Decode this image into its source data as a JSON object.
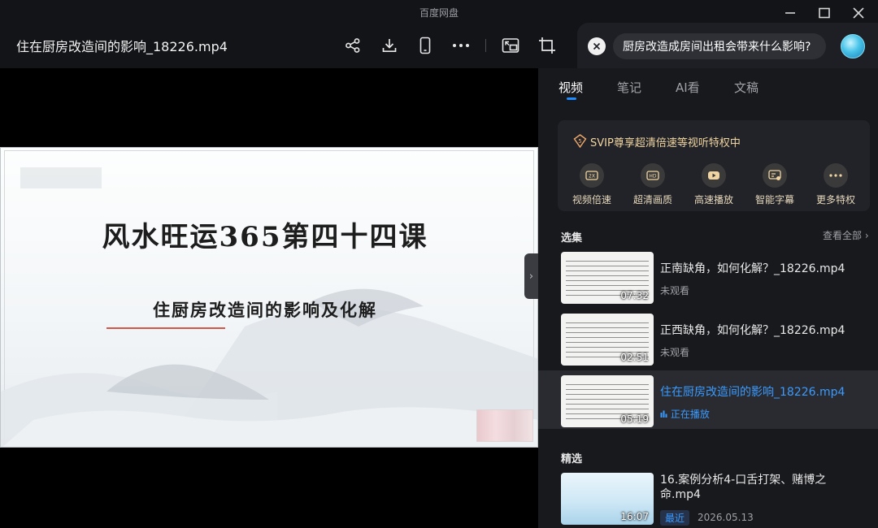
{
  "app": {
    "title": "百度网盘",
    "file_title": "住在厨房改造间的影响_18226.mp4"
  },
  "toolbar": {
    "icons": [
      "share-icon",
      "download-icon",
      "phone-icon",
      "more-icon",
      "pip-icon",
      "fullscreen-icon"
    ]
  },
  "search": {
    "query": "厨房改造成房间出租会带来什么影响?"
  },
  "slide": {
    "title": "风水旺运365第四十四课",
    "subtitle": "住厨房改造间的影响及化解"
  },
  "tabs": [
    {
      "label": "视频",
      "active": true
    },
    {
      "label": "笔记",
      "active": false
    },
    {
      "label": "AI看",
      "active": false
    },
    {
      "label": "文稿",
      "active": false
    }
  ],
  "svip": {
    "banner": "SVIP尊享超清倍速等视听特权中",
    "privileges": [
      {
        "label": "视频倍速",
        "icon": "speed-icon"
      },
      {
        "label": "超清画质",
        "icon": "hd-icon"
      },
      {
        "label": "高速播放",
        "icon": "fast-play-icon"
      },
      {
        "label": "智能字幕",
        "icon": "subtitle-icon"
      },
      {
        "label": "更多特权",
        "icon": "more-icon"
      }
    ]
  },
  "episodes": {
    "section_title": "选集",
    "view_all": "查看全部",
    "items": [
      {
        "title": "正南缺角，如何化解？_18226.mp4",
        "status": "未观看",
        "duration": "07:32",
        "current": false
      },
      {
        "title": "正西缺角，如何化解？_18226.mp4",
        "status": "未观看",
        "duration": "02:51",
        "current": false
      },
      {
        "title": "住在厨房改造间的影响_18226.mp4",
        "status": "正在播放",
        "duration": "05:19",
        "current": true
      }
    ]
  },
  "picks": {
    "section_title": "精选",
    "item": {
      "title": "16.案例分析4-口舌打架、赌博之命.mp4",
      "duration": "16:07",
      "badge": "最近",
      "date": "2026.05.13"
    }
  },
  "colors": {
    "accent": "#1f8cff",
    "svip_gold": "#f0d5a2",
    "sidebar_bg": "#18191d",
    "titlebar_bg": "#131418"
  }
}
